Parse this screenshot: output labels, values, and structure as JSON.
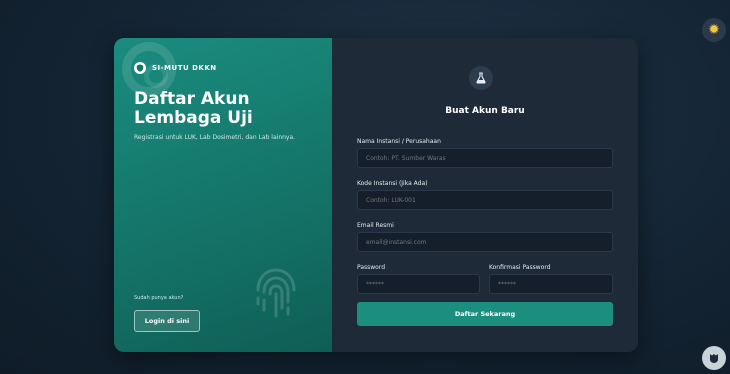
{
  "brand": {
    "name": "SI-MUTU DKKN"
  },
  "left_panel": {
    "title": "Daftar Akun Lembaga Uji",
    "subtitle": "Registrasi untuk LUK, Lab Dosimetri, dan Lab lainnya.",
    "have_account_text": "Sudah punya akun?",
    "login_button": "Login di sini"
  },
  "form": {
    "title": "Buat Akun Baru",
    "fields": {
      "nama": {
        "label": "Nama Instansi / Perusahaan",
        "placeholder": "Contoh: PT. Sumber Waras"
      },
      "kode": {
        "label": "Kode Instansi (Jika Ada)",
        "placeholder": "Contoh: LUK-001"
      },
      "email": {
        "label": "Email Resmi",
        "placeholder": "email@instansi.com"
      },
      "password": {
        "label": "Password",
        "placeholder": "******"
      },
      "confirm": {
        "label": "Konfirmasi Password",
        "placeholder": "******"
      }
    },
    "submit_label": "Daftar Sekarang"
  },
  "icons": {
    "theme_toggle": "sun-icon",
    "brand": "shield-icon",
    "form_header": "flask-icon",
    "decor": "fingerprint-icon",
    "corner": "badge-icon"
  },
  "colors": {
    "accent": "#1b8e80",
    "left_panel": "#147468",
    "form_bg": "#1e2a38",
    "page_bg": "#142433",
    "sun": "#f5c542"
  }
}
